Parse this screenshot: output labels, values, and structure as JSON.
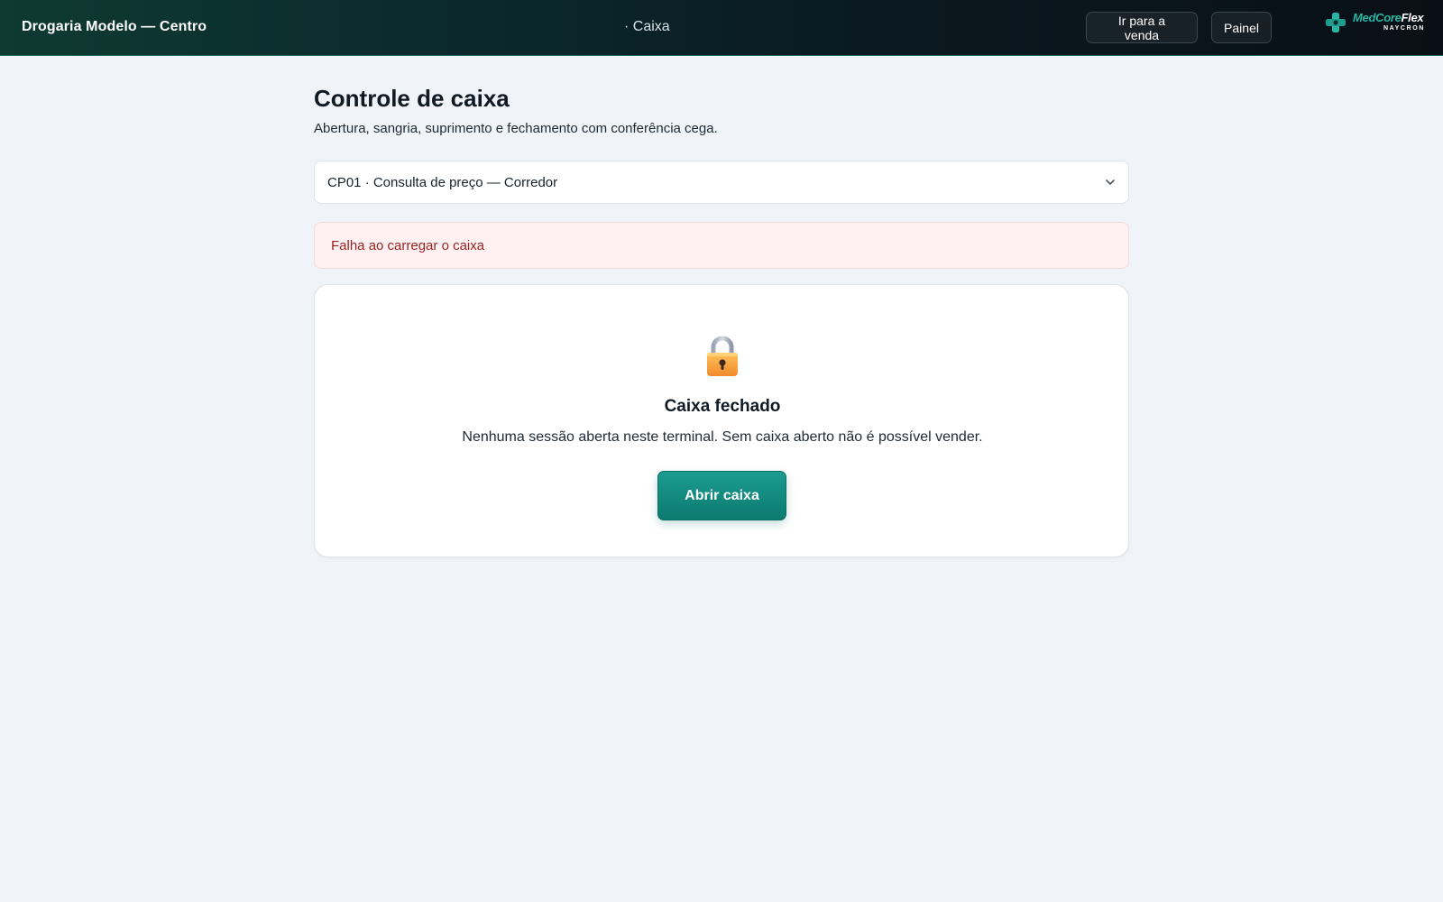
{
  "header": {
    "store_name": "Drogaria Modelo — Centro",
    "crumb": "· Caixa",
    "buttons": {
      "go_to_sale": "Ir para a venda",
      "panel": "Painel"
    },
    "brand": {
      "word_part1": "MedCore",
      "word_part2": "Flex",
      "sub": "NAYCRON",
      "accent_color": "#27b7a5"
    }
  },
  "main": {
    "title": "Controle de caixa",
    "subtitle": "Abertura, sangria, suprimento e fechamento com conferência cega.",
    "terminal_select": {
      "value": "CP01 · Consulta de preço — Corredor",
      "icon": "chevron-down-icon"
    },
    "error": {
      "message": "Falha ao carregar o caixa"
    },
    "status_card": {
      "icon": "lock-icon",
      "title": "Caixa fechado",
      "text": "Nenhuma sessão aberta neste terminal. Sem caixa aberto não é possível vender.",
      "action_label": "Abrir caixa"
    }
  },
  "colors": {
    "primary": "#0d7a70",
    "error_text": "#9b2424",
    "error_bg": "#fff1f1",
    "page_bg": "#f0f3f8"
  }
}
